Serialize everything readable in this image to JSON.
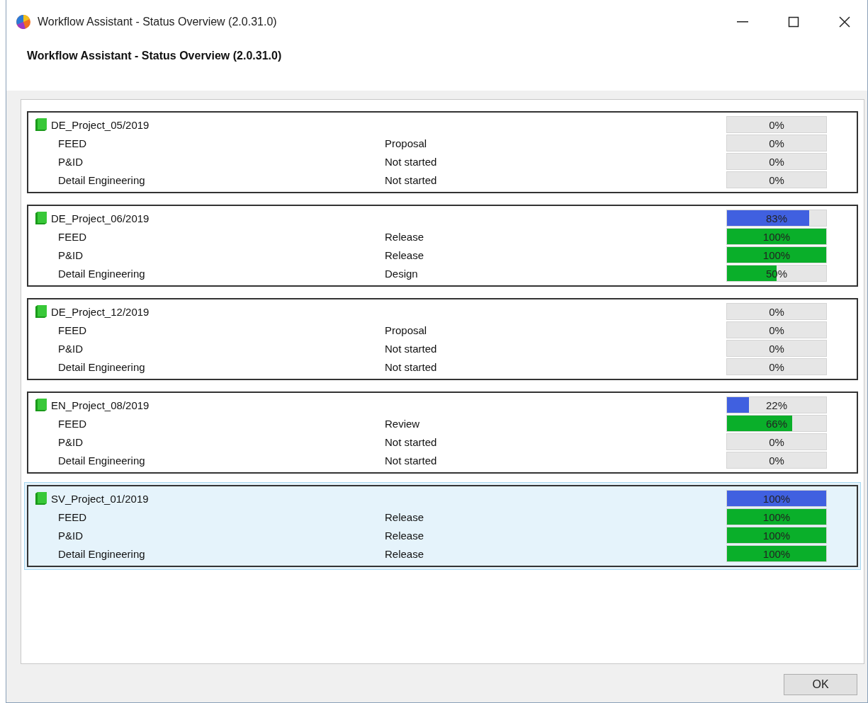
{
  "window": {
    "title": "Workflow Assistant - Status Overview (2.0.31.0)"
  },
  "header": {
    "title": "Workflow Assistant - Status Overview (2.0.31.0)"
  },
  "projects": [
    {
      "name": "DE_Project_05/2019",
      "selected": false,
      "level": 0,
      "percent": "0%",
      "steps": [
        {
          "name": "FEED",
          "status": "Proposal",
          "level": 0,
          "percent": "0%"
        },
        {
          "name": "P&ID",
          "status": "Not started",
          "level": 0,
          "percent": "0%"
        },
        {
          "name": "Detail Engineering",
          "status": "Not started",
          "level": 0,
          "percent": "0%"
        }
      ]
    },
    {
      "name": "DE_Project_06/2019",
      "selected": false,
      "level": 0.83,
      "percent": "83%",
      "steps": [
        {
          "name": "FEED",
          "status": "Release",
          "level": 1,
          "percent": "100%"
        },
        {
          "name": "P&ID",
          "status": "Release",
          "level": 1,
          "percent": "100%"
        },
        {
          "name": "Detail Engineering",
          "status": "Design",
          "level": 0.5,
          "percent": "50%"
        }
      ]
    },
    {
      "name": "DE_Project_12/2019",
      "selected": false,
      "level": 0,
      "percent": "0%",
      "steps": [
        {
          "name": "FEED",
          "status": "Proposal",
          "level": 0,
          "percent": "0%"
        },
        {
          "name": "P&ID",
          "status": "Not started",
          "level": 0,
          "percent": "0%"
        },
        {
          "name": "Detail Engineering",
          "status": "Not started",
          "level": 0,
          "percent": "0%"
        }
      ]
    },
    {
      "name": "EN_Project_08/2019",
      "selected": false,
      "level": 0.22,
      "percent": "22%",
      "steps": [
        {
          "name": "FEED",
          "status": "Review",
          "level": 0.66,
          "percent": "66%"
        },
        {
          "name": "P&ID",
          "status": "Not started",
          "level": 0,
          "percent": "0%"
        },
        {
          "name": "Detail Engineering",
          "status": "Not started",
          "level": 0,
          "percent": "0%"
        }
      ]
    },
    {
      "name": "SV_Project_01/2019",
      "selected": true,
      "level": 1,
      "percent": "100%",
      "steps": [
        {
          "name": "FEED",
          "status": "Release",
          "level": 1,
          "percent": "100%"
        },
        {
          "name": "P&ID",
          "status": "Release",
          "level": 1,
          "percent": "100%"
        },
        {
          "name": "Detail Engineering",
          "status": "Release",
          "level": 1,
          "percent": "100%"
        }
      ]
    }
  ],
  "buttons": [
    {
      "label": "OK"
    }
  ]
}
